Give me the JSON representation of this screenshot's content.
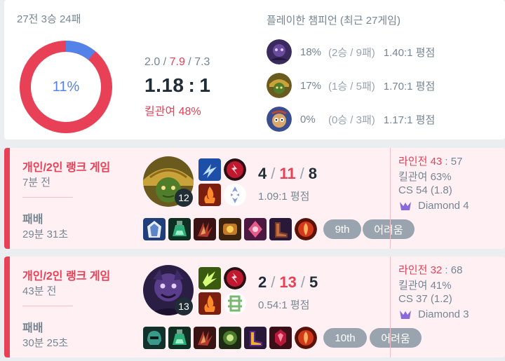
{
  "summary": {
    "record": "27전 3승 24패",
    "winrate_text": "11%",
    "winrate_fraction": 0.11,
    "kda_kills": "2.0",
    "kda_deaths": "7.9",
    "kda_assists": "7.3",
    "kda_ratio_left": "1.18",
    "kda_ratio_right": "1",
    "kill_participation": "킬관여 48%",
    "champ_title": "플레이한 챔피언 (최근 27게임)",
    "champions": [
      {
        "icon": "champion-purple-portrait",
        "pct": "18%",
        "wl": "(2승 / 9패)",
        "kda": "1.40:1 평점"
      },
      {
        "icon": "champion-green-gold-portrait",
        "pct": "17%",
        "wl": "(1승 / 5패)",
        "kda": "1.70:1 평점"
      },
      {
        "icon": "champion-blue-yordle-portrait",
        "pct": "0%",
        "wl": "(0승 / 3패)",
        "kda": "1.17:1 평점"
      }
    ]
  },
  "matches": [
    {
      "queue": "개인/2인 랭크 게임",
      "ago": "7분 전",
      "result": "패배",
      "duration": "29분 31초",
      "champ_icon": "champion-green-gold-portrait",
      "level": "12",
      "kills": "4",
      "deaths": "11",
      "assists": "8",
      "rating": "1.09:1 평점",
      "place_tag": "9th",
      "difficulty_tag": "어려움",
      "laning_label": "라인전",
      "laning_a": "43",
      "laning_b": "57",
      "kp": "킬관여 63%",
      "cs": "CS 54 (1.8)",
      "tier": "Diamond 4"
    },
    {
      "queue": "개인/2인 랭크 게임",
      "ago": "43분 전",
      "result": "패배",
      "duration": "30분 25초",
      "champ_icon": "champion-purple-portrait",
      "level": "13",
      "kills": "2",
      "deaths": "13",
      "assists": "5",
      "rating": "0.54:1 평점",
      "place_tag": "10th",
      "difficulty_tag": "어려움",
      "laning_label": "라인전",
      "laning_a": "32",
      "laning_b": "68",
      "kp": "킬관여 41%",
      "cs": "CS 37 (1.2)",
      "tier": "Diamond 3"
    }
  ],
  "colors": {
    "loss": "#e84057",
    "win": "#5383e8",
    "loss_bg": "#fff1f3",
    "muted": "#758592"
  }
}
